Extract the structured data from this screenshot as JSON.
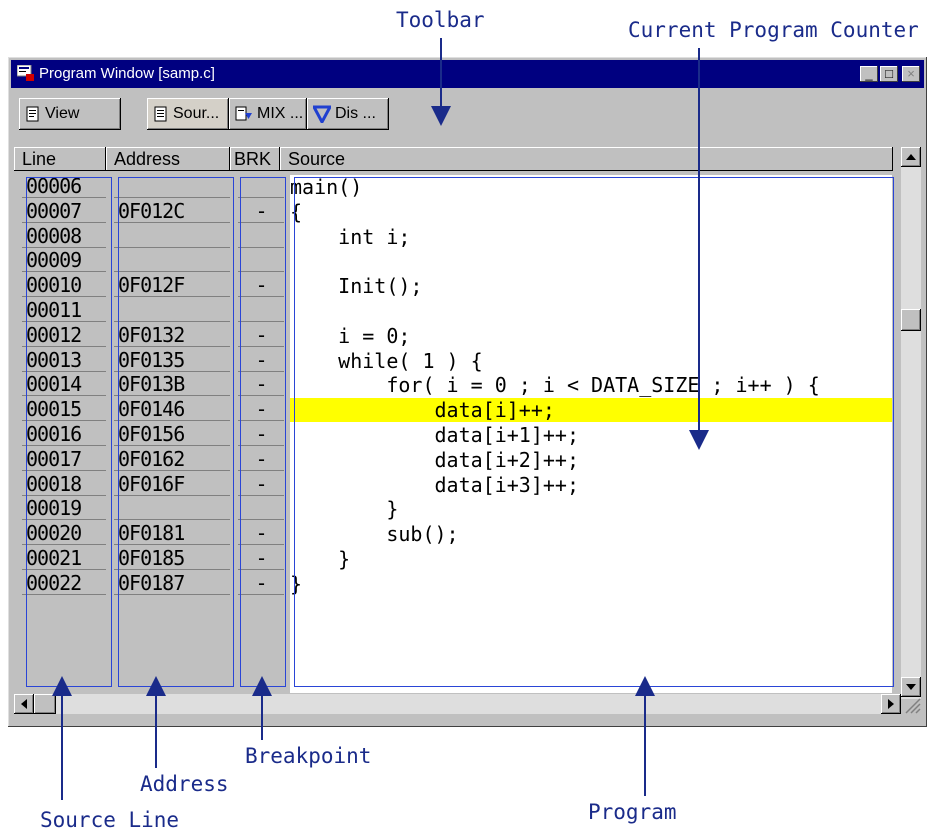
{
  "annotations": {
    "toolbar": "Toolbar",
    "current_pc": "Current Program Counter",
    "source_line": "Source Line",
    "address": "Address",
    "breakpoint": "Breakpoint",
    "program": "Program"
  },
  "window": {
    "title": "Program Window [samp.c]",
    "controls": {
      "minimize": "_",
      "maximize": "□",
      "close": "×"
    }
  },
  "toolbar": {
    "view": "View",
    "source": "Sour...",
    "mix": "MIX ...",
    "dis": "Dis ..."
  },
  "columns": {
    "line": "Line",
    "address": "Address",
    "brk": "BRK",
    "source": "Source"
  },
  "rows": [
    {
      "line": "00006",
      "address": "",
      "brk": "",
      "source": "main()"
    },
    {
      "line": "00007",
      "address": "0F012C",
      "brk": "-",
      "source": "{"
    },
    {
      "line": "00008",
      "address": "",
      "brk": "",
      "source": "    int i;"
    },
    {
      "line": "00009",
      "address": "",
      "brk": "",
      "source": ""
    },
    {
      "line": "00010",
      "address": "0F012F",
      "brk": "-",
      "source": "    Init();"
    },
    {
      "line": "00011",
      "address": "",
      "brk": "",
      "source": ""
    },
    {
      "line": "00012",
      "address": "0F0132",
      "brk": "-",
      "source": "    i = 0;"
    },
    {
      "line": "00013",
      "address": "0F0135",
      "brk": "-",
      "source": "    while( 1 ) {"
    },
    {
      "line": "00014",
      "address": "0F013B",
      "brk": "-",
      "source": "        for( i = 0 ; i < DATA_SIZE ; i++ ) {"
    },
    {
      "line": "00015",
      "address": "0F0146",
      "brk": "-",
      "source": "            data[i]++;"
    },
    {
      "line": "00016",
      "address": "0F0156",
      "brk": "-",
      "source": "            data[i+1]++;"
    },
    {
      "line": "00017",
      "address": "0F0162",
      "brk": "-",
      "source": "            data[i+2]++;"
    },
    {
      "line": "00018",
      "address": "0F016F",
      "brk": "-",
      "source": "            data[i+3]++;"
    },
    {
      "line": "00019",
      "address": "",
      "brk": "",
      "source": "        }"
    },
    {
      "line": "00020",
      "address": "0F0181",
      "brk": "-",
      "source": "        sub();"
    },
    {
      "line": "00021",
      "address": "0F0185",
      "brk": "-",
      "source": "    }"
    },
    {
      "line": "00022",
      "address": "0F0187",
      "brk": "-",
      "source": "}"
    }
  ],
  "current_pc_row": 9,
  "colors": {
    "title_bar": "#000080",
    "highlight": "#ffff00",
    "annotation": "#2a45d6"
  }
}
